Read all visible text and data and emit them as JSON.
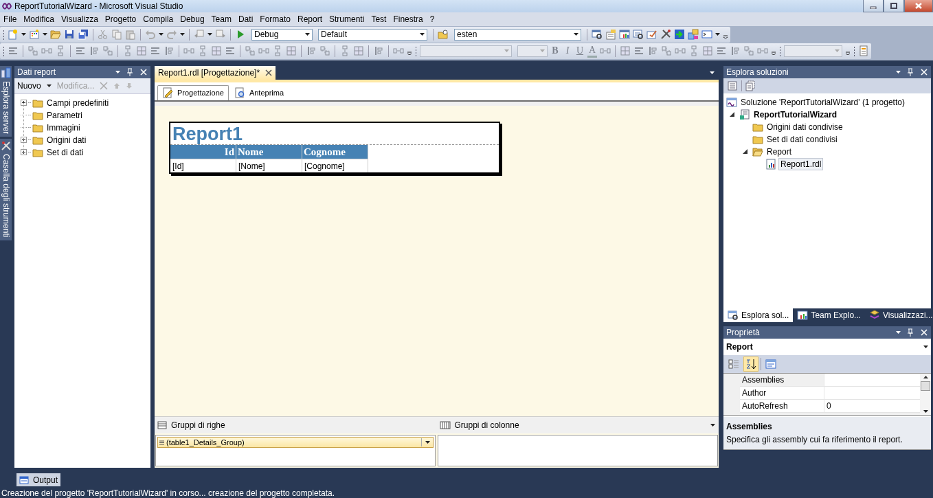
{
  "window": {
    "title": "ReportTutorialWizard - Microsoft Visual Studio"
  },
  "menu": [
    "File",
    "Modifica",
    "Visualizza",
    "Progetto",
    "Compila",
    "Debug",
    "Team",
    "Dati",
    "Formato",
    "Report",
    "Strumenti",
    "Test",
    "Finestra",
    "?"
  ],
  "toolbar": {
    "configuration": "Debug",
    "platform": "Default",
    "find": "esten",
    "format_buttons": [
      {
        "label": "B",
        "kind": "bold"
      },
      {
        "label": "I",
        "kind": "italic"
      },
      {
        "label": "U",
        "kind": "underline"
      },
      {
        "label": "A",
        "kind": "color"
      }
    ]
  },
  "side_tabs": [
    {
      "label": "Esplora server",
      "kind": "server"
    },
    {
      "label": "Casella degli strumenti",
      "kind": "tools"
    }
  ],
  "report_data": {
    "title": "Dati report",
    "new": "Nuovo",
    "edit": "Modifica...",
    "items": [
      {
        "label": "Campi predefiniti",
        "expandable": true
      },
      {
        "label": "Parametri",
        "expandable": false
      },
      {
        "label": "Immagini",
        "expandable": false
      },
      {
        "label": "Origini dati",
        "expandable": true
      },
      {
        "label": "Set di dati",
        "expandable": true
      }
    ]
  },
  "document": {
    "tabs": [
      {
        "label": "Report1.rdl [Progettazione]*",
        "selected": true
      }
    ],
    "view_tabs": [
      {
        "label": "Progettazione",
        "kind": "design",
        "selected": true
      },
      {
        "label": "Anteprima",
        "kind": "preview",
        "selected": false
      }
    ],
    "report": {
      "title": "Report1",
      "columns": [
        {
          "header": "Id",
          "field": "[Id]",
          "align_right": true
        },
        {
          "header": "Nome",
          "field": "[Nome]",
          "align_right": false
        },
        {
          "header": "Cognome",
          "field": "[Cognome]",
          "align_right": false
        }
      ]
    },
    "row_groups": {
      "title": "Gruppi di righe",
      "items": [
        "(table1_Details_Group)"
      ]
    },
    "column_groups": {
      "title": "Gruppi di colonne"
    }
  },
  "solution_explorer": {
    "title": "Esplora soluzioni",
    "tree": [
      {
        "label": "Soluzione 'ReportTutorialWizard'  (1 progetto)",
        "kind": "solution",
        "selected": false,
        "children": [
          {
            "label": "ReportTutorialWizard",
            "kind": "project",
            "selected": false,
            "expanded": true,
            "children": [
              {
                "label": "Origini dati condivise",
                "kind": "folder",
                "selected": false
              },
              {
                "label": "Set di dati condivisi",
                "kind": "folder",
                "selected": false
              },
              {
                "label": "Report",
                "kind": "folder",
                "selected": false,
                "expanded": true,
                "children": [
                  {
                    "label": "Report1.rdl",
                    "kind": "file",
                    "selected": true
                  }
                ]
              }
            ]
          }
        ]
      }
    ],
    "tabs": [
      {
        "label": "Esplora sol...",
        "kind": "solution",
        "selected": true
      },
      {
        "label": "Team Explo...",
        "kind": "team",
        "selected": false
      },
      {
        "label": "Visualizzazi...",
        "kind": "class",
        "selected": false
      }
    ]
  },
  "properties": {
    "title": "Proprietà",
    "object": "Report",
    "alphabetical": true,
    "rows": [
      {
        "name": "Assemblies",
        "selected": true
      },
      {
        "name": "Author",
        "selected": false
      },
      {
        "name": "AutoRefresh",
        "value": "0",
        "selected": false
      }
    ],
    "description": {
      "title": "Assemblies",
      "text": "Specifica gli assembly cui fa riferimento il report."
    }
  },
  "output_tab": {
    "label": "Output"
  },
  "status_bar": {
    "text": "Creazione del progetto 'ReportTutorialWizard' in corso... creazione del progetto completata."
  }
}
